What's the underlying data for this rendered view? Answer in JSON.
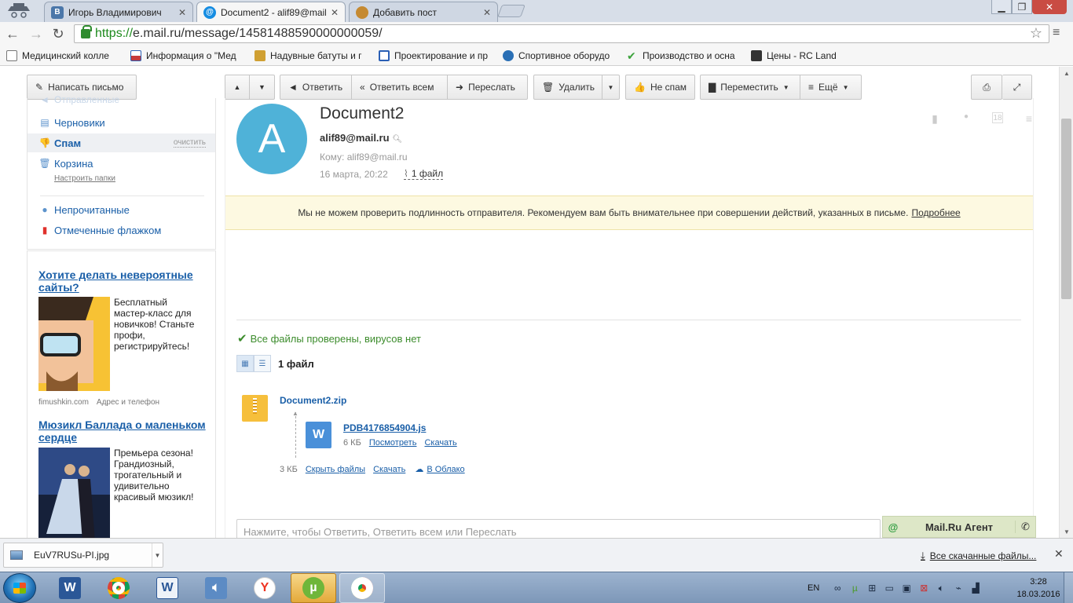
{
  "browser": {
    "tabs": [
      {
        "title": "Игорь Владимирович",
        "favicon": "В",
        "color": "#4b77a9"
      },
      {
        "title": "Document2 - alif89@mail.",
        "favicon": "@",
        "color": "#168de2"
      },
      {
        "title": "Добавить пост",
        "favicon": "",
        "color": "#c58a32"
      }
    ],
    "url_scheme": "https://",
    "url_host": "e.mail.ru",
    "url_path": "/message/14581488590000000059/",
    "bookmarks": [
      {
        "label": "Медицинский колле",
        "color": "#777777"
      },
      {
        "label": "Информация о \"Мед",
        "color": "#c63a3a"
      },
      {
        "label": "Надувные батуты и г",
        "color": "#d0a032"
      },
      {
        "label": "Проектирование и пр",
        "color": "#2a5fb5"
      },
      {
        "label": "Спортивное оборудо",
        "color": "#2a6fb5"
      },
      {
        "label": "Производство и осна",
        "color": "#3ca33c"
      },
      {
        "label": "Цены - RC Land",
        "color": "#333333"
      }
    ]
  },
  "toolbar": {
    "compose": "Написать письмо",
    "reply": "Ответить",
    "reply_all": "Ответить всем",
    "forward": "Переслать",
    "delete": "Удалить",
    "not_spam": "Не спам",
    "move": "Переместить",
    "more": "Ещё"
  },
  "sidebar": {
    "sent_partial": "Отправленные",
    "drafts": "Черновики",
    "spam": "Спам",
    "spam_clear": "очистить",
    "trash": "Корзина",
    "setup_folders": "Настроить папки",
    "unread": "Непрочитанные",
    "flagged": "Отмеченные флажком"
  },
  "ads": [
    {
      "title": "Хотите делать невероятные сайты?",
      "text": "Бесплатный мастер-класс для новичков! Станьте профи, регистрируйтесь!",
      "site": "fimushkin.com",
      "contact": "Адрес и телефон"
    },
    {
      "title": "Мюзикл Баллада о маленьком сердце",
      "text": "Премьера сезона! Грандиозный, трогательный и удивительно красивый мюзикл!"
    }
  ],
  "message": {
    "subject": "Document2",
    "avatar_letter": "A",
    "from": "alif89@mail.ru",
    "to": "Кому: alif89@mail.ru",
    "date": "16 марта, 20:22",
    "files_link": "1 файл",
    "warning": "Мы не можем проверить подлинность отправителя. Рекомендуем вам быть внимательнее при совершении действий, указанных в письме.",
    "warning_link": "Подробнее",
    "virus_status": "Все файлы проверены, вирусов нет",
    "file_count": "1 файл",
    "archive": {
      "name": "Document2.zip",
      "size": "3 КБ",
      "hide": "Скрыть файлы",
      "download": "Скачать",
      "cloud": "В Облако"
    },
    "inner_file": {
      "name": "PDB4176854904.js",
      "size": "6 КБ",
      "view": "Посмотреть",
      "download": "Скачать"
    },
    "reply_placeholder": "Нажмите, чтобы Ответить, Ответить всем или Переслать"
  },
  "agent": {
    "label": "Mail.Ru Агент"
  },
  "downloads": {
    "item": "EuV7RUSu-PI.jpg",
    "all": "Все скачанные файлы..."
  },
  "taskbar": {
    "lang": "EN",
    "time": "3:28",
    "date": "18.03.2016"
  }
}
